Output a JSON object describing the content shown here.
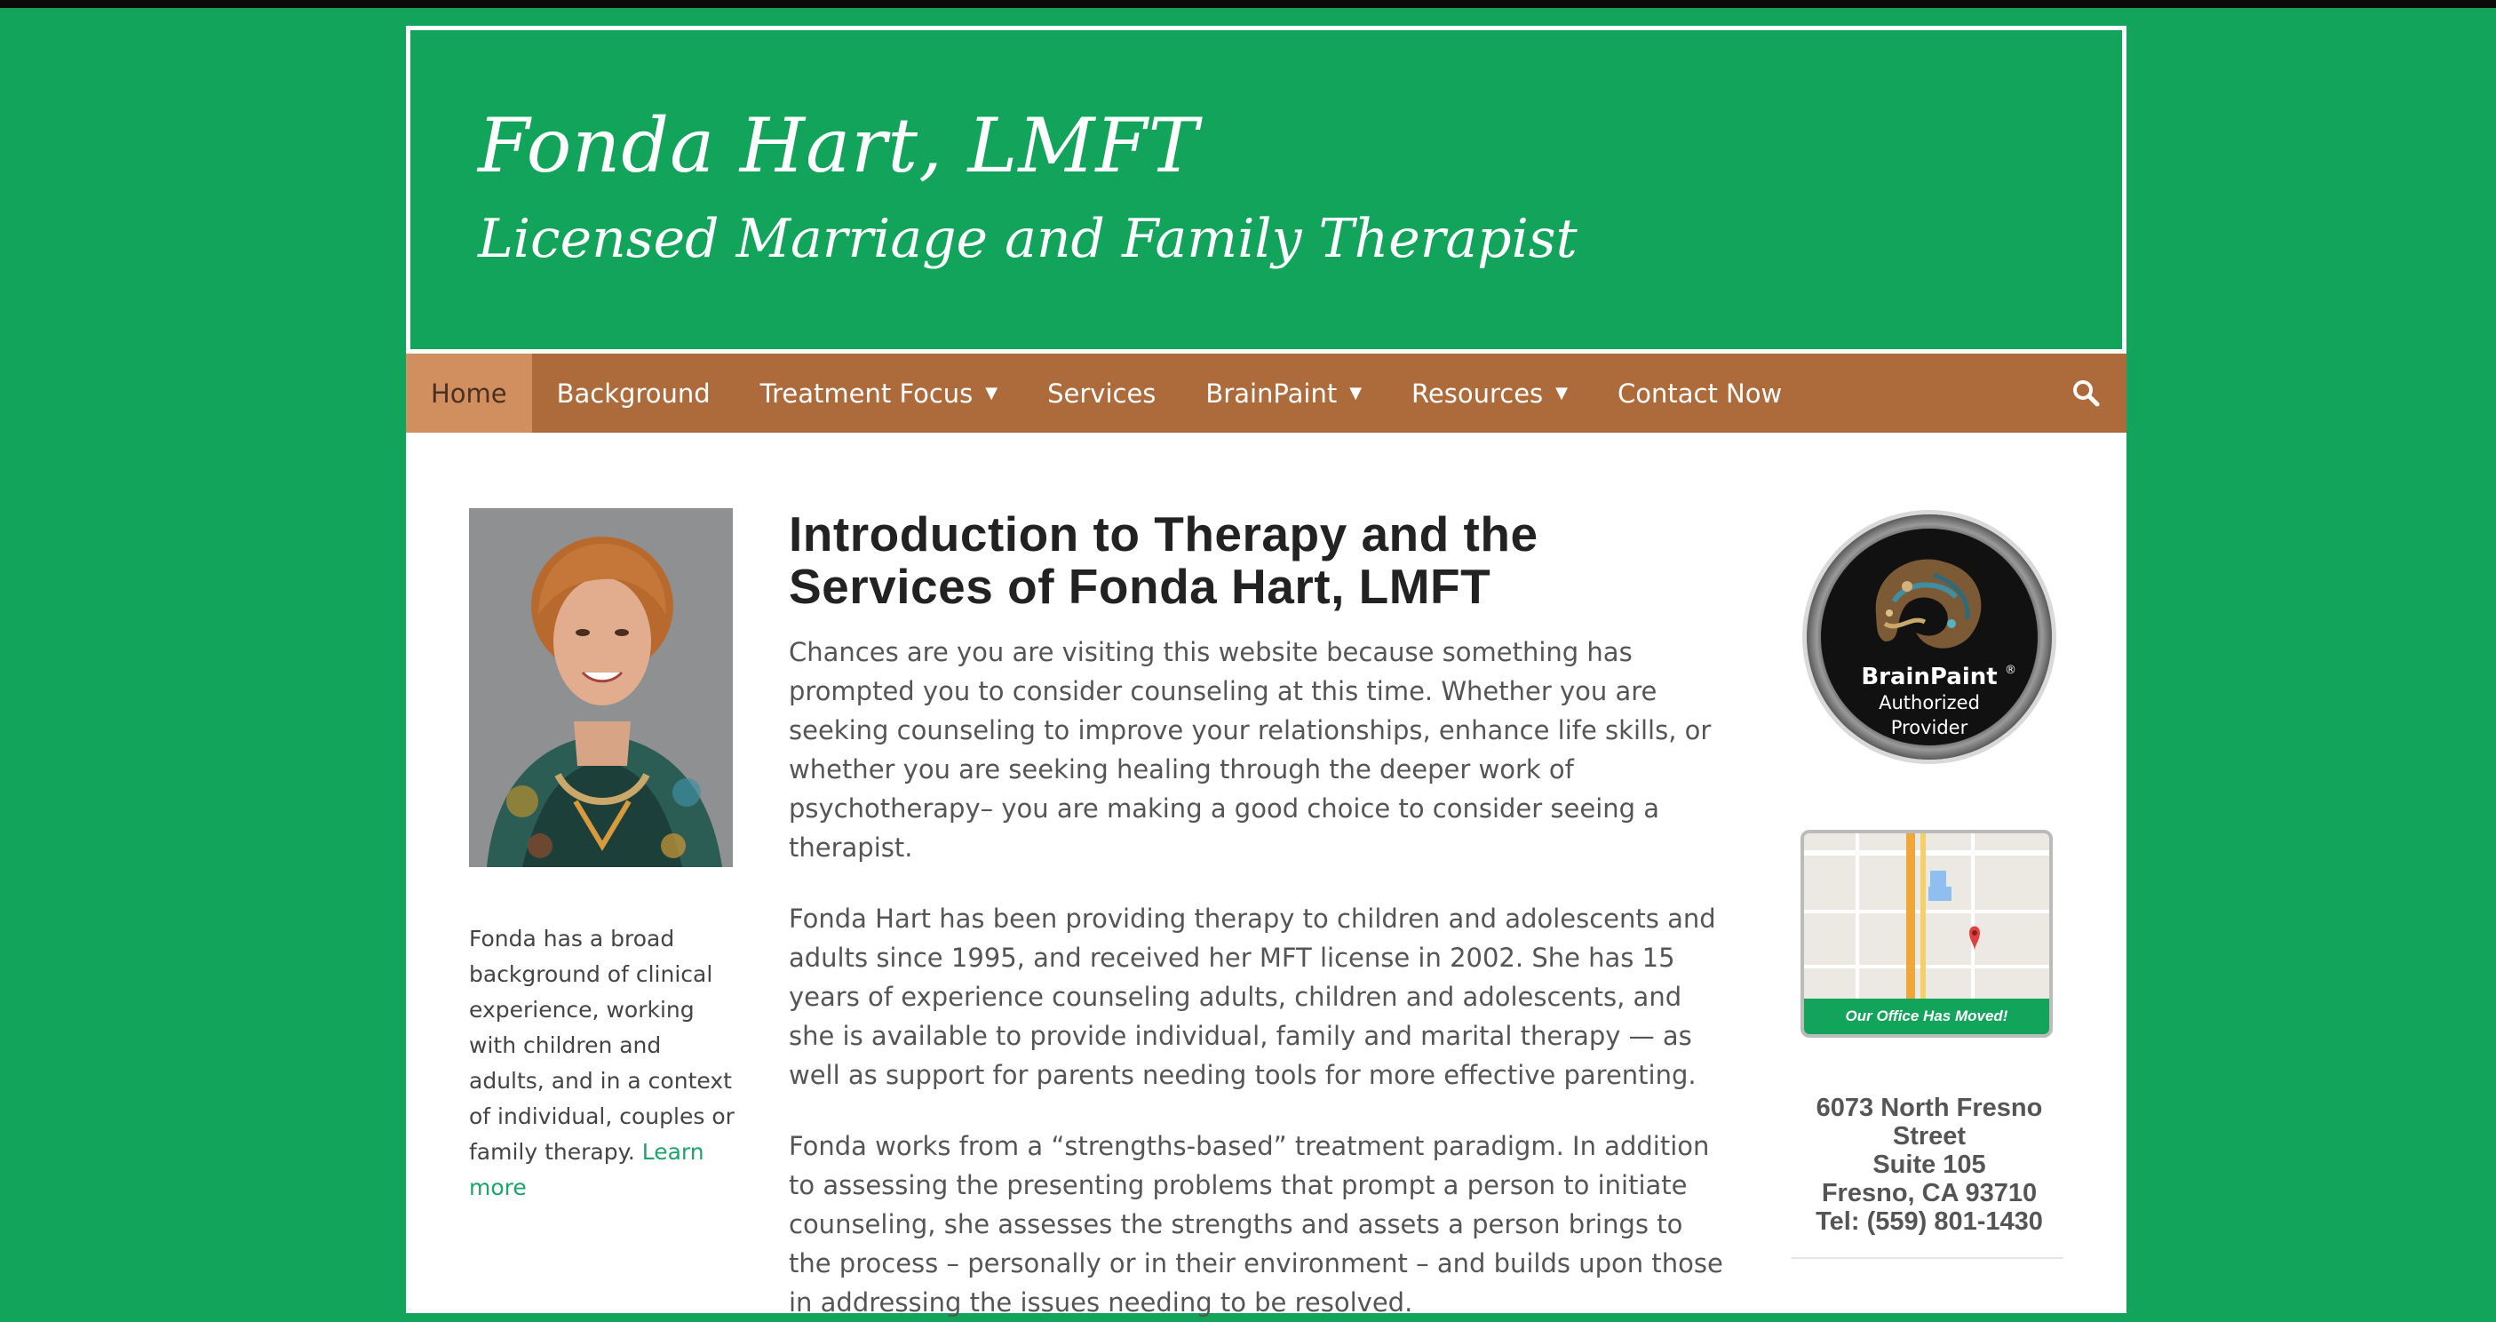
{
  "header": {
    "title": "Fonda Hart, LMFT",
    "tagline": "Licensed Marriage and Family Therapist"
  },
  "nav": {
    "items": [
      {
        "label": "Home",
        "active": true,
        "dropdown": false
      },
      {
        "label": "Background",
        "active": false,
        "dropdown": false
      },
      {
        "label": "Treatment Focus",
        "active": false,
        "dropdown": true
      },
      {
        "label": "Services",
        "active": false,
        "dropdown": false
      },
      {
        "label": "BrainPaint",
        "active": false,
        "dropdown": true
      },
      {
        "label": "Resources",
        "active": false,
        "dropdown": true
      },
      {
        "label": "Contact Now",
        "active": false,
        "dropdown": false
      }
    ],
    "search_icon": "search-icon"
  },
  "left": {
    "bio": "Fonda has a broad background of clinical experience, working with children and adults, and in a context of individual, couples or family therapy.",
    "learn_more": "Learn more"
  },
  "main": {
    "heading": "Introduction to Therapy and the Services of Fonda Hart, LMFT",
    "paragraphs": [
      "Chances are you are visiting this website because something has prompted you to consider counseling at this time. Whether you are seeking counseling to improve your relationships, enhance life skills, or whether you are seeking healing through the deeper work of psychotherapy– you are making a good choice to consider seeing a therapist.",
      "Fonda Hart has been providing therapy to children and adolescents and adults since 1995, and received her MFT license in 2002. She has 15 years of experience counseling adults, children and adolescents, and she is available to provide individual, family and marital therapy — as well as support for parents needing tools for more effective parenting.",
      "Fonda works from a “strengths-based” treatment paradigm. In addition to assessing the presenting problems that prompt a person to initiate counseling, she assesses the strengths and assets a person brings to the process – personally or in their environment – and builds upon those in addressing the issues needing to be resolved."
    ]
  },
  "sidebar": {
    "badge": {
      "brand": "BrainPaint",
      "registered": "®",
      "line2": "Authorized",
      "line3": "Provider"
    },
    "map": {
      "banner": "Our Office Has Moved!"
    },
    "address": {
      "line1": "6073 North Fresno",
      "line2": "Street",
      "line3": "Suite 105",
      "line4": "Fresno, CA 93710",
      "line5": "Tel: (559) 801-1430"
    }
  },
  "colors": {
    "background": "#12a45a",
    "nav": "#ad6a3b",
    "nav_active": "#d18e5e",
    "link": "#1ea36b"
  }
}
